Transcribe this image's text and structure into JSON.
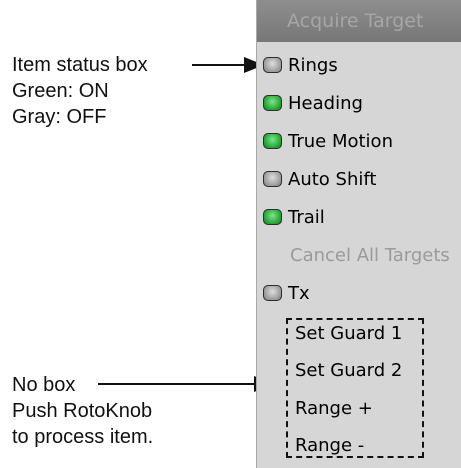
{
  "annotations": {
    "status_box": [
      "Item status box",
      "Green: ON",
      "Gray: OFF"
    ],
    "no_box": [
      "No box",
      "Push RotoKnob",
      "to process item."
    ]
  },
  "menu": {
    "header": "Acquire Target",
    "items": [
      {
        "label": "Rings",
        "state": "off"
      },
      {
        "label": "Heading",
        "state": "on"
      },
      {
        "label": "True Motion",
        "state": "on"
      },
      {
        "label": "Auto Shift",
        "state": "off"
      },
      {
        "label": "Trail",
        "state": "on"
      },
      {
        "label": "Cancel All Targets",
        "state": "disabled"
      },
      {
        "label": "Tx",
        "state": "off"
      },
      {
        "label": "Set Guard 1",
        "state": "none"
      },
      {
        "label": "Set Guard 2",
        "state": "none"
      },
      {
        "label": "Range +",
        "state": "none"
      },
      {
        "label": "Range -",
        "state": "none"
      }
    ]
  },
  "colors": {
    "status_on": "#21a331",
    "status_off": "#9a9a9a",
    "panel_bg": "#d6d6d6",
    "disabled_text": "#9a9a9a"
  }
}
